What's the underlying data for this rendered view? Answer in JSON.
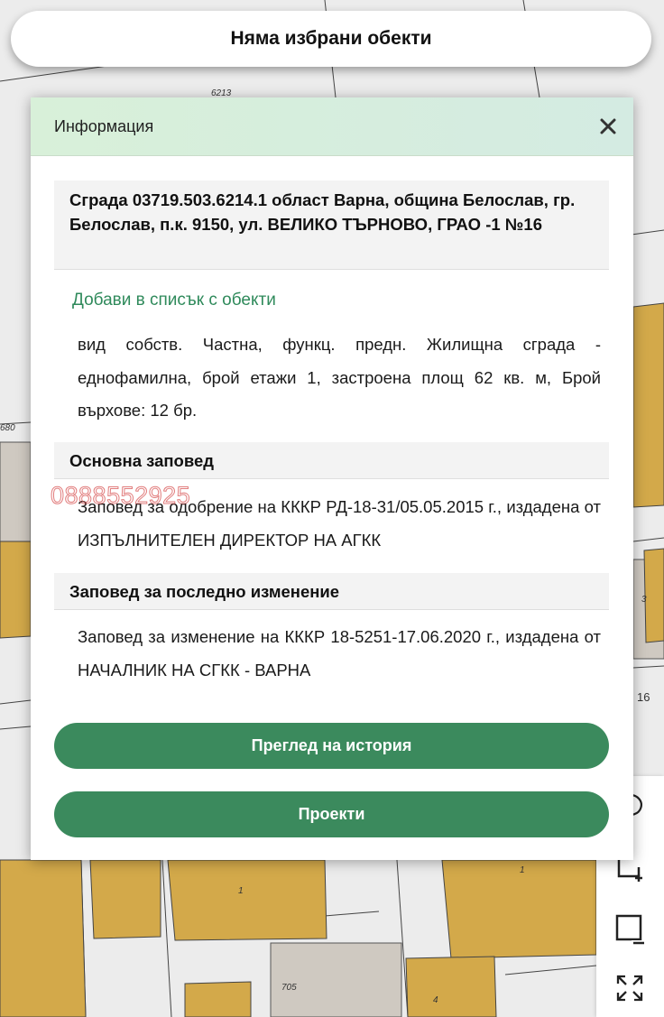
{
  "top_bar": {
    "label": "Няма избрани обекти"
  },
  "map": {
    "parcel_numbers": [
      "6213",
      "680",
      "3",
      "16",
      "1",
      "1",
      "705",
      "4"
    ],
    "colors": {
      "parcel_fill": "#d3a94a",
      "background": "#ececec",
      "grey_building": "#cfc9c1"
    }
  },
  "dialog": {
    "title": "Информация",
    "close_icon": "close-icon",
    "building_title": "Сграда 03719.503.6214.1 област Варна, община Белослав, гр. Белослав, п.к. 9150, ул. ВЕЛИКО ТЪРНОВО, ГРАО -1 №16",
    "add_link": "Добави в списък с обекти",
    "description": "вид собств. Частна, функц. предн. Жилищна сграда - еднофамилна, брой етажи 1, застроена площ 62 кв. м, Брой върхове: 12 бр.",
    "main_order_heading": "Основна заповед",
    "main_order_text": "Заповед за одобрение на КККР РД-18-31/05.05.2015 г., издадена от ИЗПЪЛНИТЕЛЕН ДИРЕКТОР НА АГКК",
    "last_change_heading": "Заповед за последно изменение",
    "last_change_text": "Заповед за изменение на КККР 18-5251-17.06.2020 г., издадена от НАЧАЛНИК НА СГКК - ВАРНА",
    "watermark": "0888552925",
    "history_button": "Преглед на история",
    "projects_button": "Проекти"
  },
  "map_tools": [
    "comment-icon",
    "add-area-icon",
    "remove-area-icon",
    "fullscreen-icon"
  ],
  "colors": {
    "accent": "#3b8a5d",
    "link": "#2f8a5b",
    "header_bg": "#d8f0d9"
  }
}
